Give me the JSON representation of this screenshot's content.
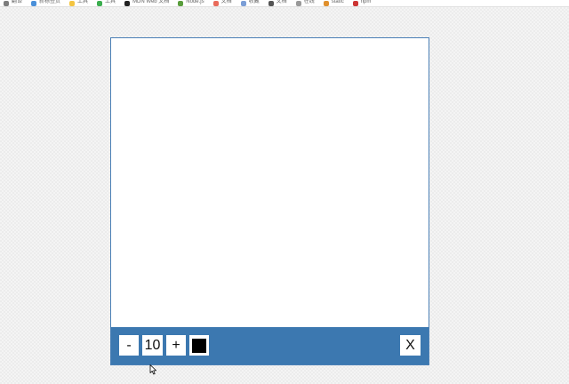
{
  "bookmarks": [
    {
      "label": "翻译",
      "color": "#7d7d7d"
    },
    {
      "label": "新标签页",
      "color": "#4a90d9"
    },
    {
      "label": "工具",
      "color": "#f4c542"
    },
    {
      "label": "工具",
      "color": "#3cae4f"
    },
    {
      "label": "MDN Web 文档",
      "color": "#222222"
    },
    {
      "label": "Node.js",
      "color": "#5a9e3d"
    },
    {
      "label": "文档",
      "color": "#e96b5b"
    },
    {
      "label": "收藏",
      "color": "#7b9ed6"
    },
    {
      "label": "文档",
      "color": "#555555"
    },
    {
      "label": "在线",
      "color": "#9a9a9a"
    },
    {
      "label": "static",
      "color": "#e0902d"
    },
    {
      "label": "npm",
      "color": "#cc3534"
    }
  ],
  "toolbar": {
    "decrease_label": "-",
    "size_value": "10",
    "increase_label": "+",
    "close_label": "X",
    "brush_color": "#000000"
  }
}
